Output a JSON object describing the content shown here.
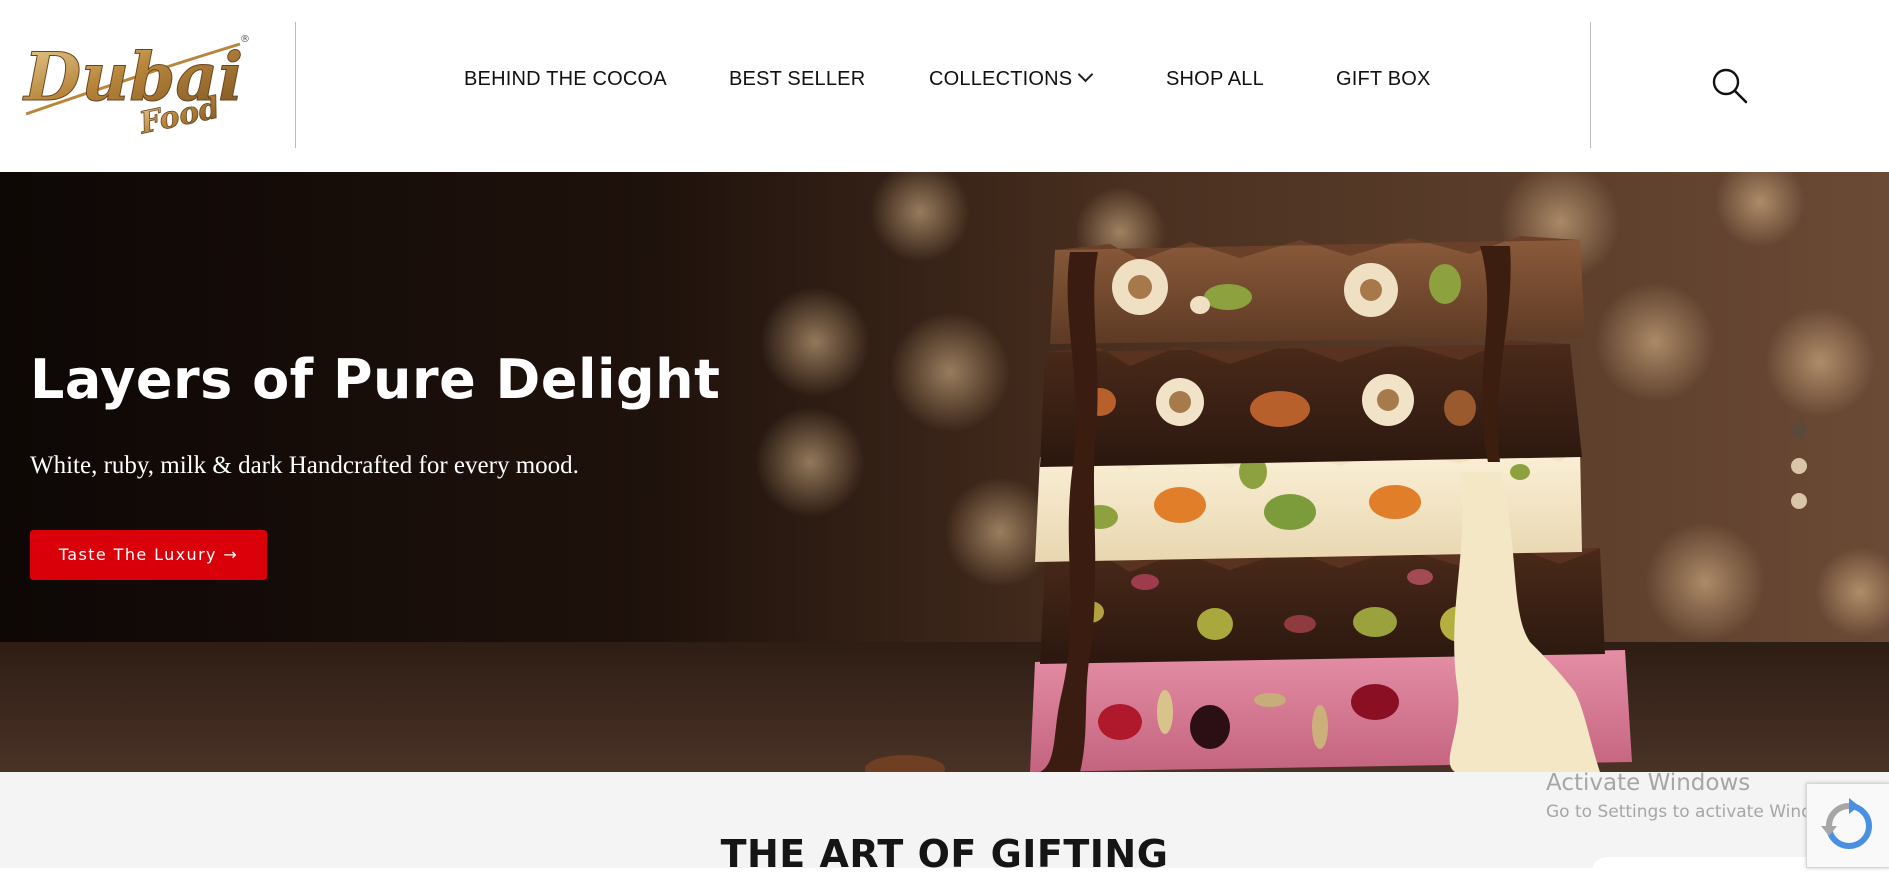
{
  "brand": {
    "logo_line1": "Dubai",
    "logo_line2": "Food",
    "registered_mark": "®"
  },
  "nav": {
    "items": [
      {
        "label": "BEHIND THE COCOA"
      },
      {
        "label": "BEST SELLER"
      },
      {
        "label": "COLLECTIONS",
        "has_dropdown": true
      },
      {
        "label": "SHOP ALL"
      },
      {
        "label": "GIFT BOX"
      }
    ],
    "search_icon": "search-icon"
  },
  "hero": {
    "title": "Layers of Pure Delight",
    "subtitle": "White, ruby, milk & dark Handcrafted for every mood.",
    "cta_label": "Taste The Luxury →",
    "slides_total": 3,
    "active_slide": 1
  },
  "section": {
    "title": "THE ART OF GIFTING"
  },
  "os_overlay": {
    "activate_title": "Activate Windows",
    "activate_subtitle": "Go to Settings to activate Windows."
  },
  "colors": {
    "cta_red": "#d90009",
    "logo_gold": "#b8863b",
    "hero_dark": "#1a0f0a"
  }
}
